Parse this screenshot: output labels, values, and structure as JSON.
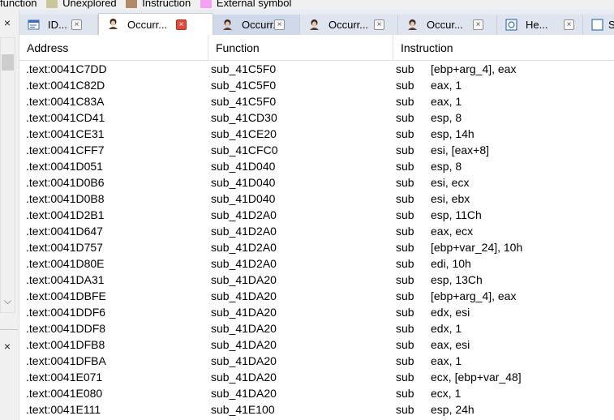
{
  "legend": [
    {
      "label": "function",
      "color": ""
    },
    {
      "label": "Unexplored",
      "color": "#c8c69a"
    },
    {
      "label": "Instruction",
      "color": "#b38866"
    },
    {
      "label": "External symbol",
      "color": "#f4a0f4"
    }
  ],
  "left_panel": {
    "close_glyph": "×",
    "scroll_down_glyph": "⌵"
  },
  "tabs": [
    {
      "label": "ID...",
      "icon": "ida-view-icon",
      "active": false
    },
    {
      "label": "Occurr...",
      "icon": "occurrences-icon",
      "active": true
    },
    {
      "label": "Occurr...",
      "icon": "occurrences-icon",
      "active": false,
      "highlight": true
    },
    {
      "label": "Occurr...",
      "icon": "occurrences-icon",
      "active": false
    },
    {
      "label": "Occur...",
      "icon": "occurrences-icon",
      "active": false
    },
    {
      "label": "He...",
      "icon": "hex-view-icon",
      "active": false
    },
    {
      "label": "S",
      "icon": "structures-icon",
      "active": false
    }
  ],
  "tab_close_glyph": "×",
  "table": {
    "columns": [
      "Address",
      "Function",
      "Instruction"
    ],
    "rows": [
      [
        ".text:0041C7DD",
        "sub_41C5F0",
        "sub",
        "[ebp+arg_4], eax"
      ],
      [
        ".text:0041C82D",
        "sub_41C5F0",
        "sub",
        "eax, 1"
      ],
      [
        ".text:0041C83A",
        "sub_41C5F0",
        "sub",
        "eax, 1"
      ],
      [
        ".text:0041CD41",
        "sub_41CD30",
        "sub",
        "esp, 8"
      ],
      [
        ".text:0041CE31",
        "sub_41CE20",
        "sub",
        "esp, 14h"
      ],
      [
        ".text:0041CFF7",
        "sub_41CFC0",
        "sub",
        "esi, [eax+8]"
      ],
      [
        ".text:0041D051",
        "sub_41D040",
        "sub",
        "esp, 8"
      ],
      [
        ".text:0041D0B6",
        "sub_41D040",
        "sub",
        "esi, ecx"
      ],
      [
        ".text:0041D0B8",
        "sub_41D040",
        "sub",
        "esi, ebx"
      ],
      [
        ".text:0041D2B1",
        "sub_41D2A0",
        "sub",
        "esp, 11Ch"
      ],
      [
        ".text:0041D647",
        "sub_41D2A0",
        "sub",
        "eax, ecx"
      ],
      [
        ".text:0041D757",
        "sub_41D2A0",
        "sub",
        "[ebp+var_24], 10h"
      ],
      [
        ".text:0041D80E",
        "sub_41D2A0",
        "sub",
        "edi, 10h"
      ],
      [
        ".text:0041DA31",
        "sub_41DA20",
        "sub",
        "esp, 13Ch"
      ],
      [
        ".text:0041DBFE",
        "sub_41DA20",
        "sub",
        "[ebp+arg_4], eax"
      ],
      [
        ".text:0041DDF6",
        "sub_41DA20",
        "sub",
        "edx, esi"
      ],
      [
        ".text:0041DDF8",
        "sub_41DA20",
        "sub",
        "edx, 1"
      ],
      [
        ".text:0041DFB8",
        "sub_41DA20",
        "sub",
        "eax, esi"
      ],
      [
        ".text:0041DFBA",
        "sub_41DA20",
        "sub",
        "eax, 1"
      ],
      [
        ".text:0041E071",
        "sub_41DA20",
        "sub",
        "ecx, [ebp+var_48]"
      ],
      [
        ".text:0041E080",
        "sub_41DA20",
        "sub",
        "ecx, 1"
      ],
      [
        ".text:0041E111",
        "sub_41E100",
        "sub",
        "esp, 24h"
      ]
    ]
  }
}
